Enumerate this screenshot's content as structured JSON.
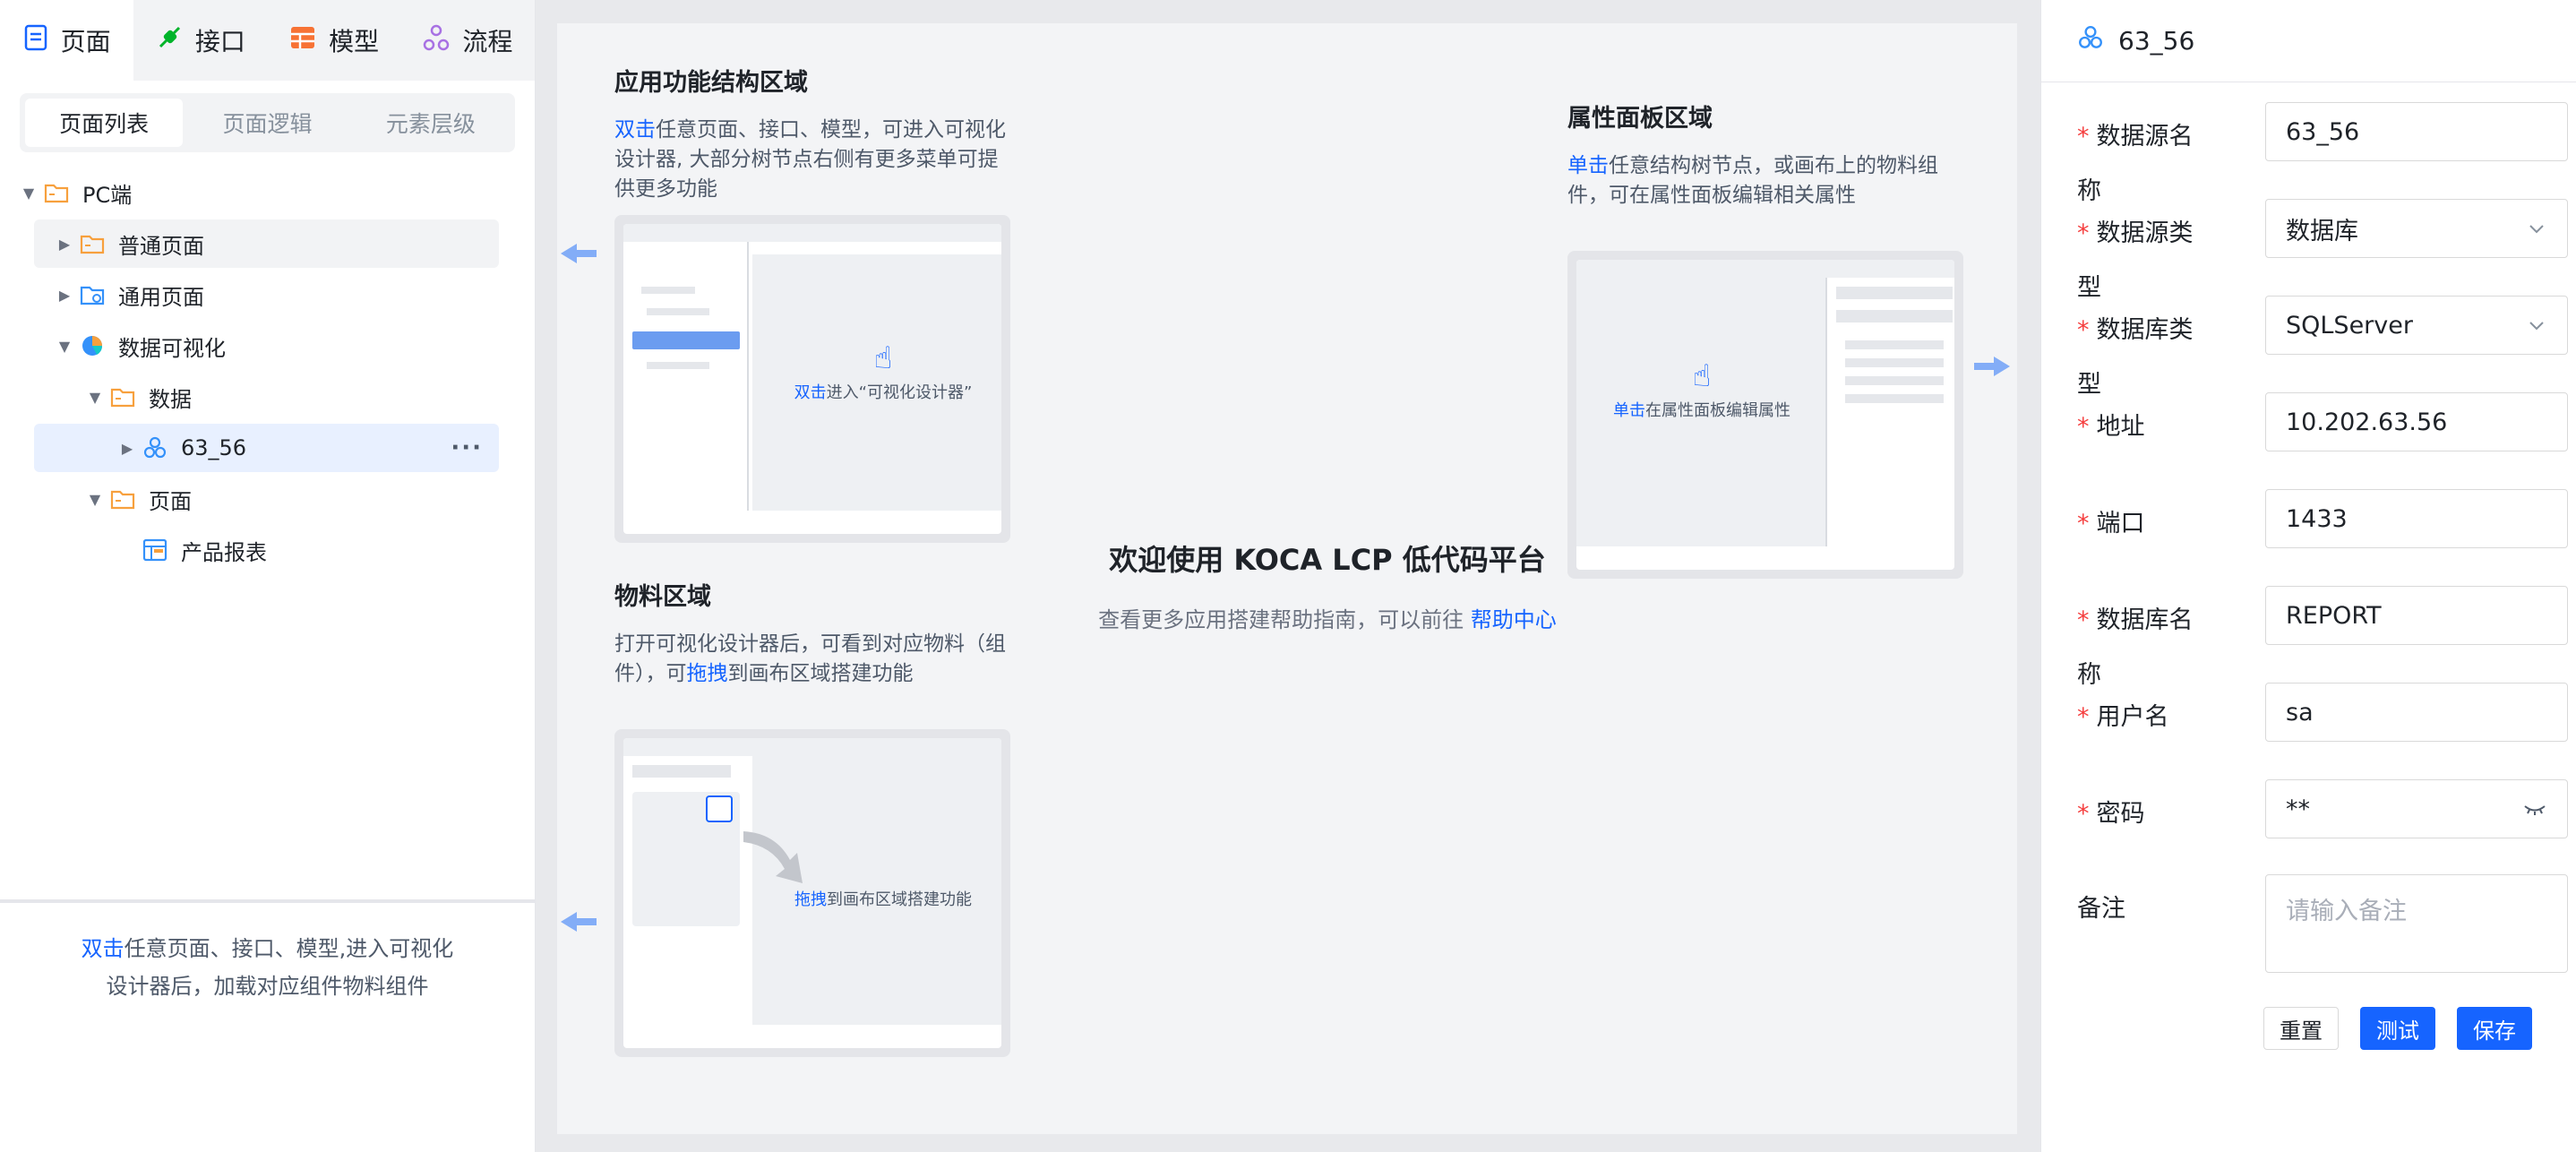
{
  "left": {
    "tabs": [
      {
        "label": "页面",
        "icon": "document-icon"
      },
      {
        "label": "接口",
        "icon": "api-icon"
      },
      {
        "label": "模型",
        "icon": "table-icon"
      },
      {
        "label": "流程",
        "icon": "flow-icon"
      }
    ],
    "segments": [
      "页面列表",
      "页面逻辑",
      "元素层级"
    ],
    "tree": [
      {
        "label": "PC端",
        "level": 0,
        "expanded": true
      },
      {
        "label": "普通页面",
        "level": 1,
        "expanded": false
      },
      {
        "label": "通用页面",
        "level": 1,
        "expanded": false
      },
      {
        "label": "数据可视化",
        "level": 1,
        "expanded": true
      },
      {
        "label": "数据",
        "level": 2,
        "expanded": true
      },
      {
        "label": "63_56",
        "level": 3,
        "expanded": false,
        "selected": true
      },
      {
        "label": "页面",
        "level": 2,
        "expanded": true
      },
      {
        "label": "产品报表",
        "level": 3
      }
    ],
    "footer": {
      "highlight": "双击",
      "line1": "任意页面、接口、模型,进入可视化",
      "line2": "设计器后，加载对应组件物料组件"
    }
  },
  "center": {
    "structure": {
      "title": "应用功能结构区域",
      "highlight": "双击",
      "desc": "任意页面、接口、模型，可进入可视化设计器, 大部分树节点右侧有更多菜单可提供更多功能",
      "mock_highlight": "双击",
      "mock_text": "进入“可视化设计器”"
    },
    "material": {
      "title": "物料区域",
      "desc1": "打开可视化设计器后，可看到对应物料（组件），可",
      "highlight": "拖拽",
      "desc2": "到画布区域搭建功能",
      "mock_highlight": "拖拽",
      "mock_text": "到画布区域搭建功能"
    },
    "props": {
      "title": "属性面板区域",
      "highlight": "单击",
      "desc": "任意结构树节点，或画布上的物料组件，可在属性面板编辑相关属性",
      "mock_highlight": "单击",
      "mock_text": "在属性面板编辑属性"
    },
    "welcome": {
      "title": "欢迎使用 KOCA LCP 低代码平台",
      "subtitle": "查看更多应用搭建帮助指南，可以前往 ",
      "link": "帮助中心"
    }
  },
  "right": {
    "title": "63_56",
    "fields": [
      {
        "label": "数据源名称",
        "value": "63_56",
        "required": true,
        "type": "text"
      },
      {
        "label": "数据源类型",
        "value": "数据库",
        "required": true,
        "type": "select"
      },
      {
        "label": "数据库类型",
        "value": "SQLServer",
        "required": true,
        "type": "select"
      },
      {
        "label": "地址",
        "value": "10.202.63.56",
        "required": true,
        "type": "text"
      },
      {
        "label": "端口",
        "value": "1433",
        "required": true,
        "type": "text"
      },
      {
        "label": "数据库名称",
        "value": "REPORT",
        "required": true,
        "type": "text"
      },
      {
        "label": "用户名",
        "value": "sa",
        "required": true,
        "type": "text"
      },
      {
        "label": "密码",
        "value": "**",
        "required": true,
        "type": "password"
      }
    ],
    "remark": {
      "label": "备注",
      "placeholder": "请输入备注"
    },
    "buttons": {
      "reset": "重置",
      "test": "测试",
      "save": "保存"
    },
    "colors": {
      "primary": "#1664ff",
      "required": "#f53f3f"
    }
  }
}
